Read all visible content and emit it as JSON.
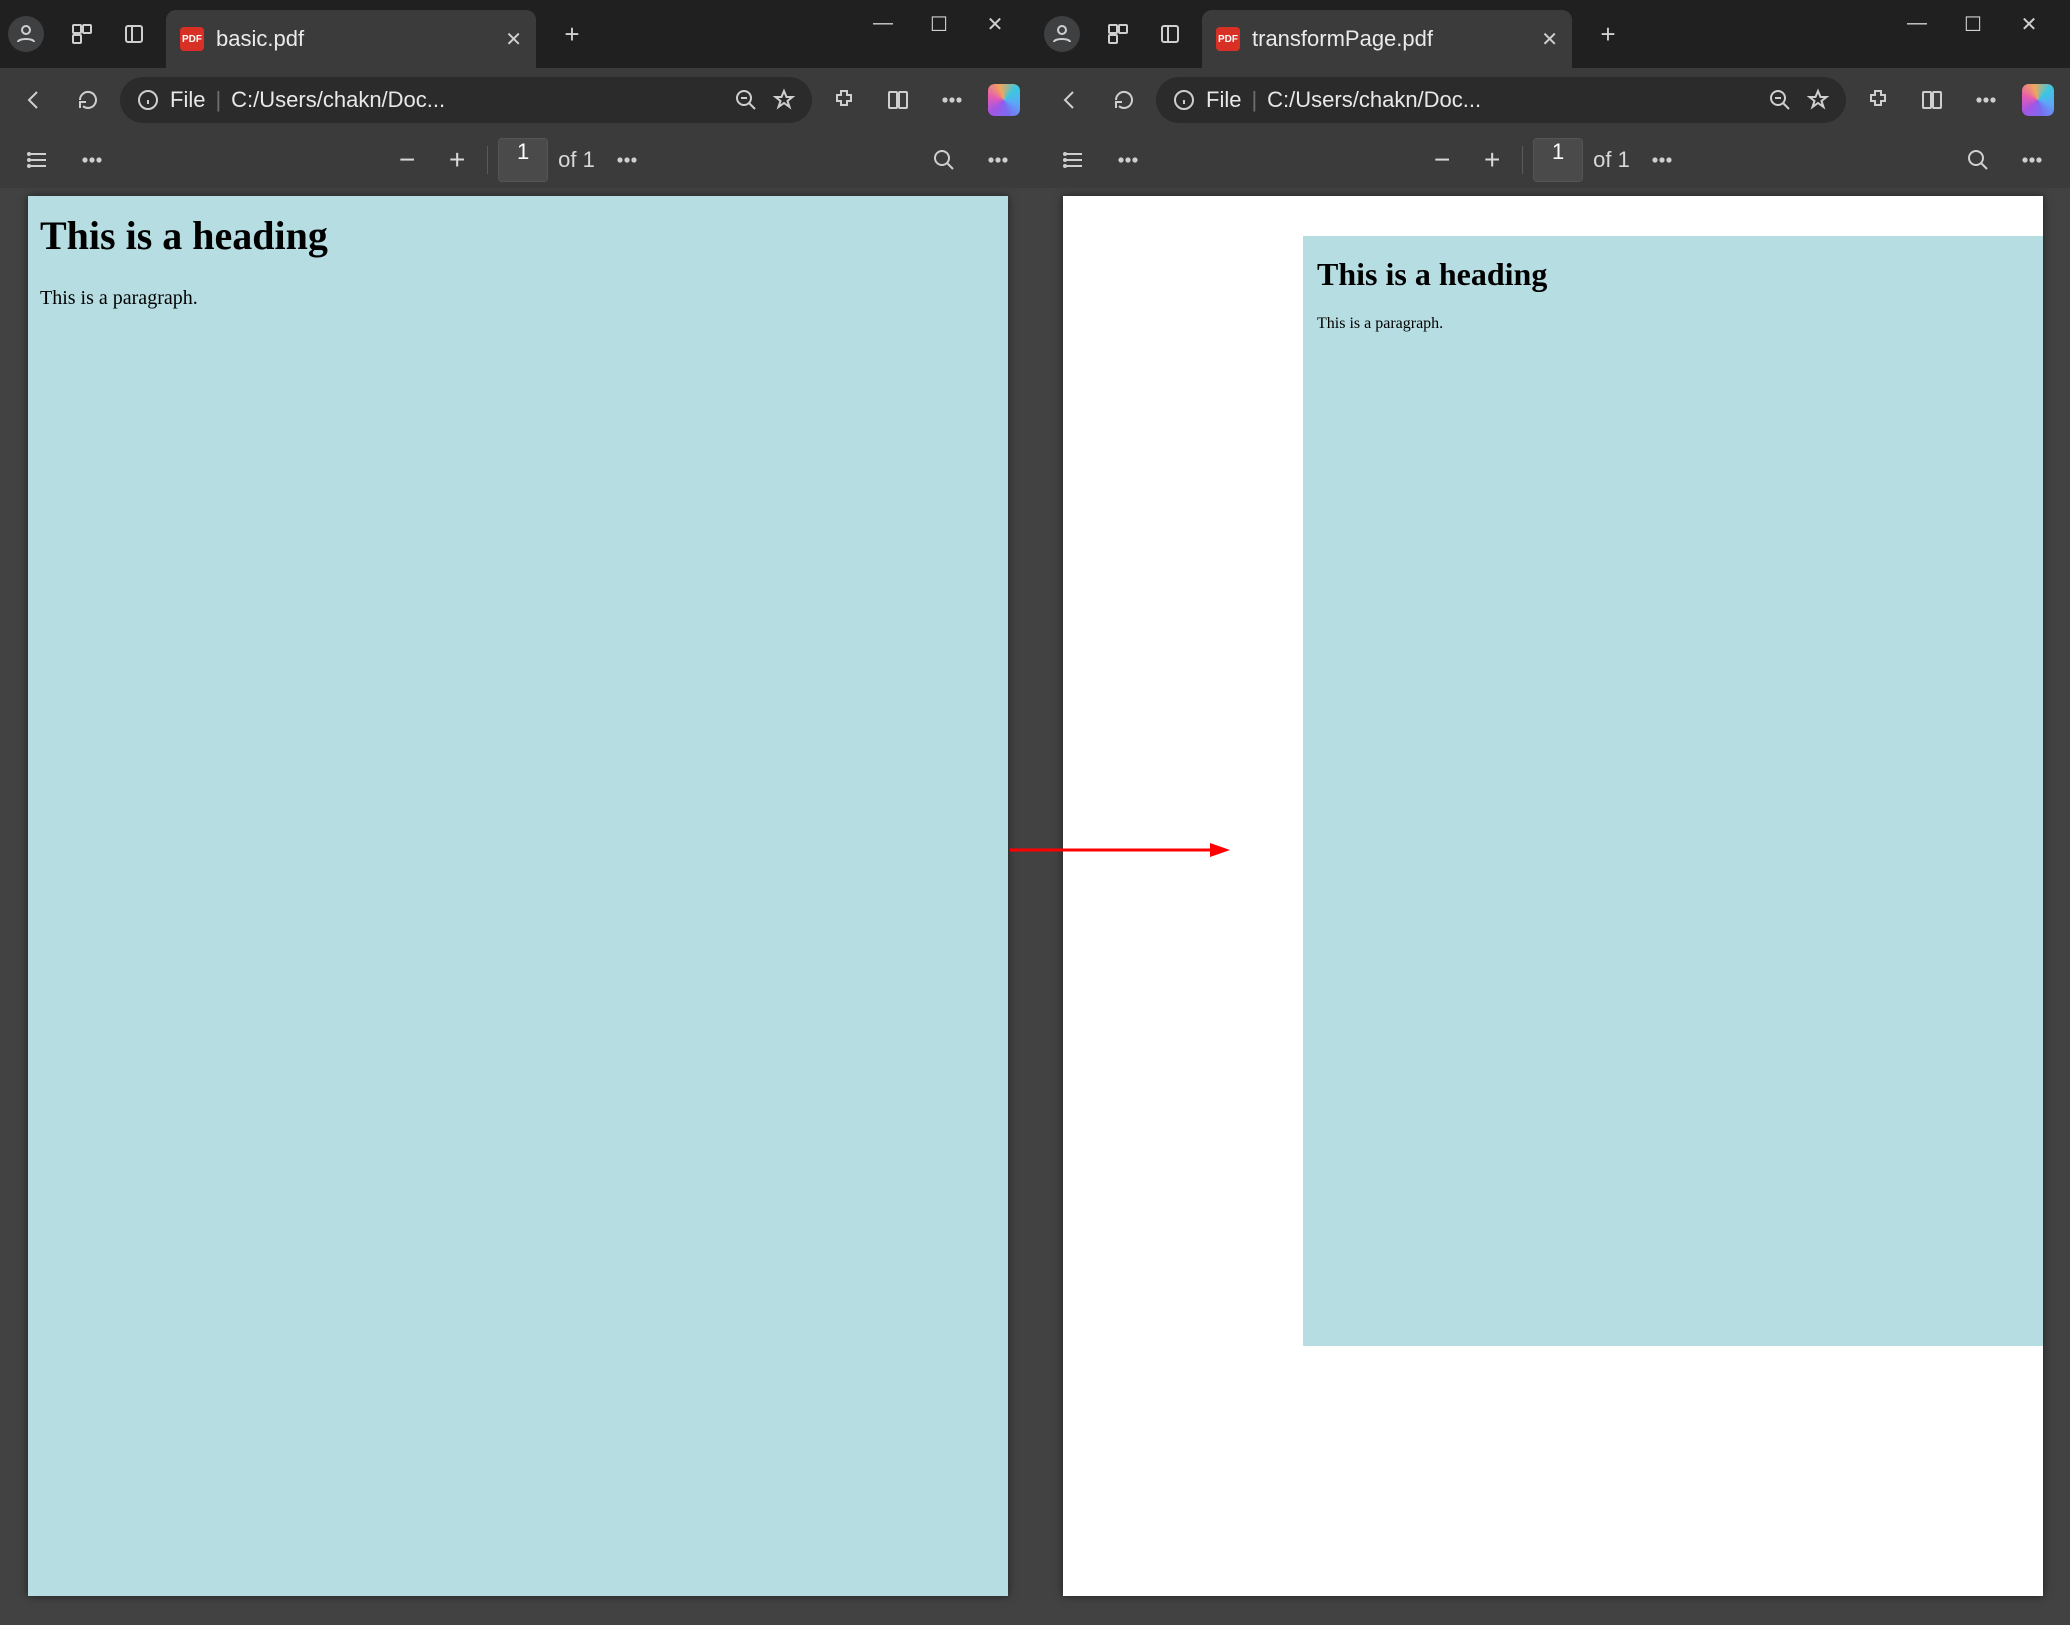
{
  "icons": {
    "person": "person-icon",
    "workspaces": "workspaces-icon",
    "tabactions": "tab-actions-icon",
    "newtab": "+",
    "min": "—",
    "max": "□",
    "close": "✕"
  },
  "windows": [
    {
      "id": "left",
      "tab": {
        "icon_text": "PDF",
        "title": "basic.pdf"
      },
      "winctrl": {
        "minimize": "—",
        "maximize": "☐",
        "close": "✕"
      },
      "address": {
        "scheme": "File",
        "path": "C:/Users/chakn/Doc..."
      },
      "pdfbar": {
        "page_value": "1",
        "page_count": "of 1"
      },
      "doc": {
        "heading": "This is a heading",
        "paragraph": "This is a paragraph."
      }
    },
    {
      "id": "right",
      "tab": {
        "icon_text": "PDF",
        "title": "transformPage.pdf"
      },
      "winctrl": {
        "minimize": "—",
        "maximize": "☐",
        "close": "✕"
      },
      "address": {
        "scheme": "File",
        "path": "C:/Users/chakn/Doc..."
      },
      "pdfbar": {
        "page_value": "1",
        "page_count": "of 1"
      },
      "doc": {
        "heading": "This is a heading",
        "paragraph": "This is a paragraph."
      }
    }
  ]
}
